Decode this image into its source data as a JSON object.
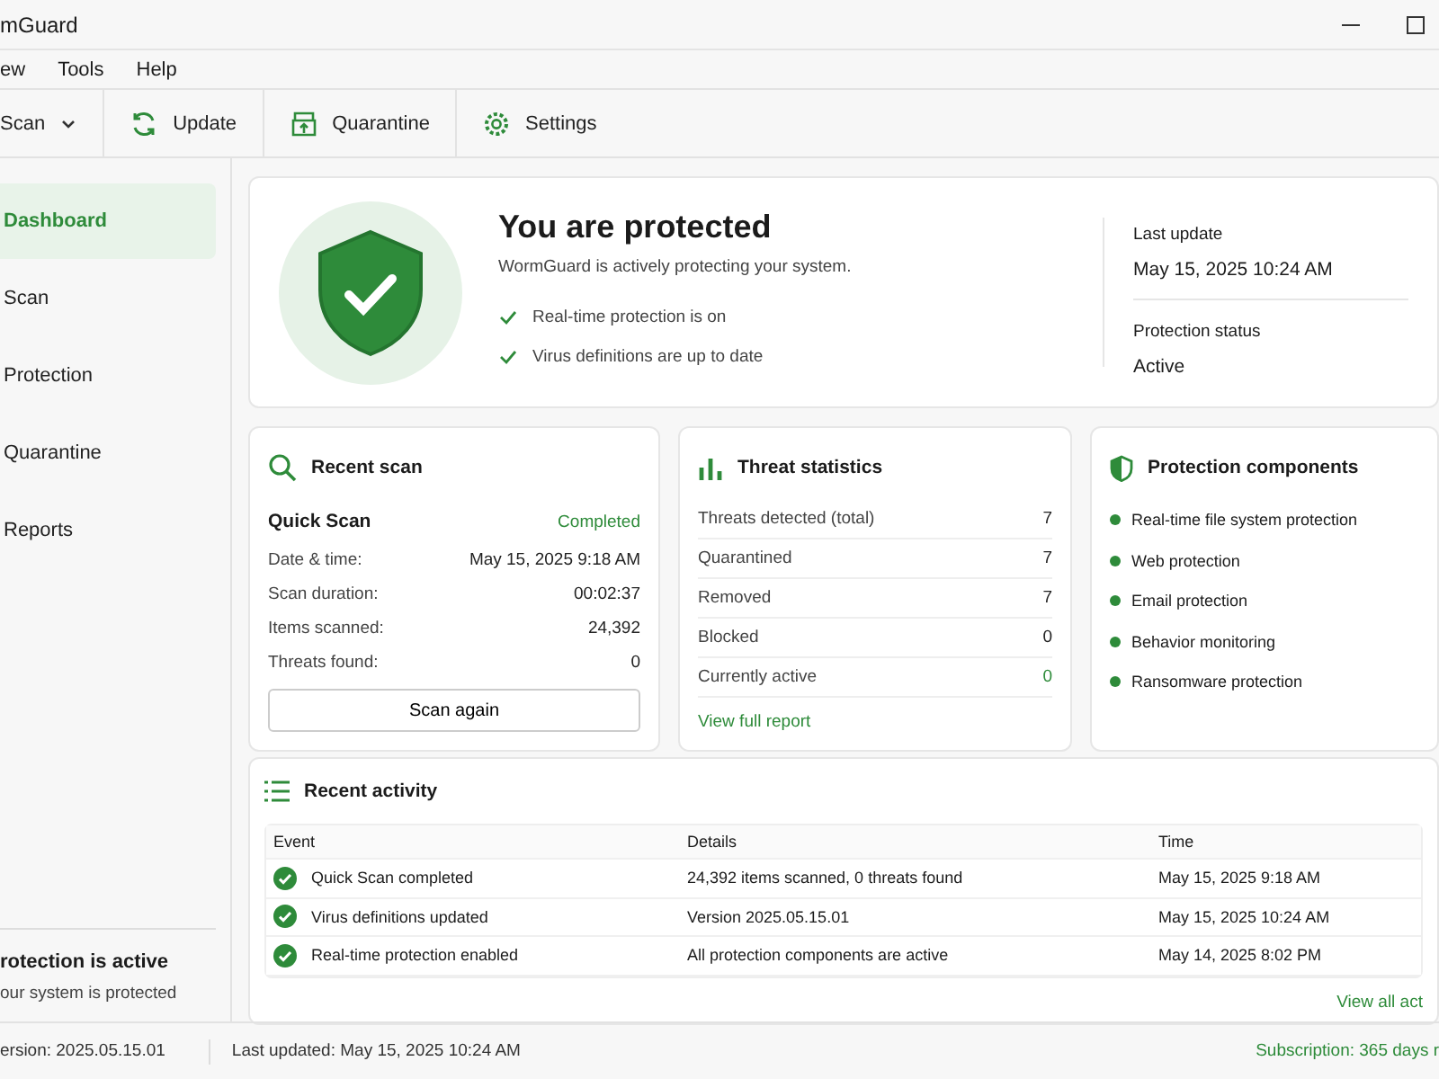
{
  "window": {
    "title": "mGuard"
  },
  "menu": [
    "ew",
    "Tools",
    "Help"
  ],
  "toolbar": [
    {
      "kind": "dropdown",
      "label": "Scan"
    },
    {
      "kind": "update",
      "label": "Update"
    },
    {
      "kind": "quarantine",
      "label": "Quarantine"
    },
    {
      "kind": "settings",
      "label": "Settings"
    }
  ],
  "sidebar": {
    "items": [
      {
        "label": "Dashboard",
        "selected": true
      },
      {
        "label": "Scan",
        "selected": false
      },
      {
        "label": "Protection",
        "selected": false
      },
      {
        "label": "Quarantine",
        "selected": false
      },
      {
        "label": "Reports",
        "selected": false
      }
    ],
    "status_title": "rotection is active",
    "status_text": "our system is protected"
  },
  "hero": {
    "title": "You are protected",
    "subtitle": "WormGuard is actively protecting your system.",
    "checks": [
      "Real-time protection is on",
      "Virus definitions are up to date"
    ],
    "info": [
      {
        "label": "Last update",
        "value": "May 15, 2025 10:24 AM"
      },
      {
        "label": "Protection status",
        "value": "Active"
      }
    ]
  },
  "recent_scan": {
    "title": "Recent scan",
    "name": "Quick Scan",
    "status": "Completed",
    "rows": [
      {
        "label": "Date & time:",
        "value": "May 15, 2025 9:18 AM"
      },
      {
        "label": "Scan duration:",
        "value": "00:02:37"
      },
      {
        "label": "Items scanned:",
        "value": "24,392"
      },
      {
        "label": "Threats found:",
        "value": "0"
      }
    ],
    "button": "Scan again"
  },
  "threat_statistics": {
    "title": "Threat statistics",
    "rows": [
      {
        "label": "Threats detected (total)",
        "value": "7",
        "highlight": false
      },
      {
        "label": "Quarantined",
        "value": "7",
        "highlight": false
      },
      {
        "label": "Removed",
        "value": "7",
        "highlight": false
      },
      {
        "label": "Blocked",
        "value": "0",
        "highlight": false
      },
      {
        "label": "Currently active",
        "value": "0",
        "highlight": true
      }
    ],
    "link": "View full report"
  },
  "protection_components": {
    "title": "Protection components",
    "items": [
      "Real-time file system protection",
      "Web protection",
      "Email protection",
      "Behavior monitoring",
      "Ransomware protection"
    ]
  },
  "recent_activity": {
    "title": "Recent activity",
    "columns": [
      "Event",
      "Details",
      "Time"
    ],
    "rows": [
      [
        "Quick Scan completed",
        "24,392 items scanned, 0 threats found",
        "May 15, 2025 9:18 AM"
      ],
      [
        "Virus definitions updated",
        "Version 2025.05.15.01",
        "May 15, 2025 10:24 AM"
      ],
      [
        "Real-time protection enabled",
        "All protection components are active",
        "May 14, 2025 8:02 PM"
      ]
    ],
    "link": "View all act"
  },
  "status_bar": {
    "version": "ersion: 2025.05.15.01",
    "updated": "Last updated: May 15, 2025 10:24 AM",
    "subscription": "Subscription: 365 days r"
  }
}
